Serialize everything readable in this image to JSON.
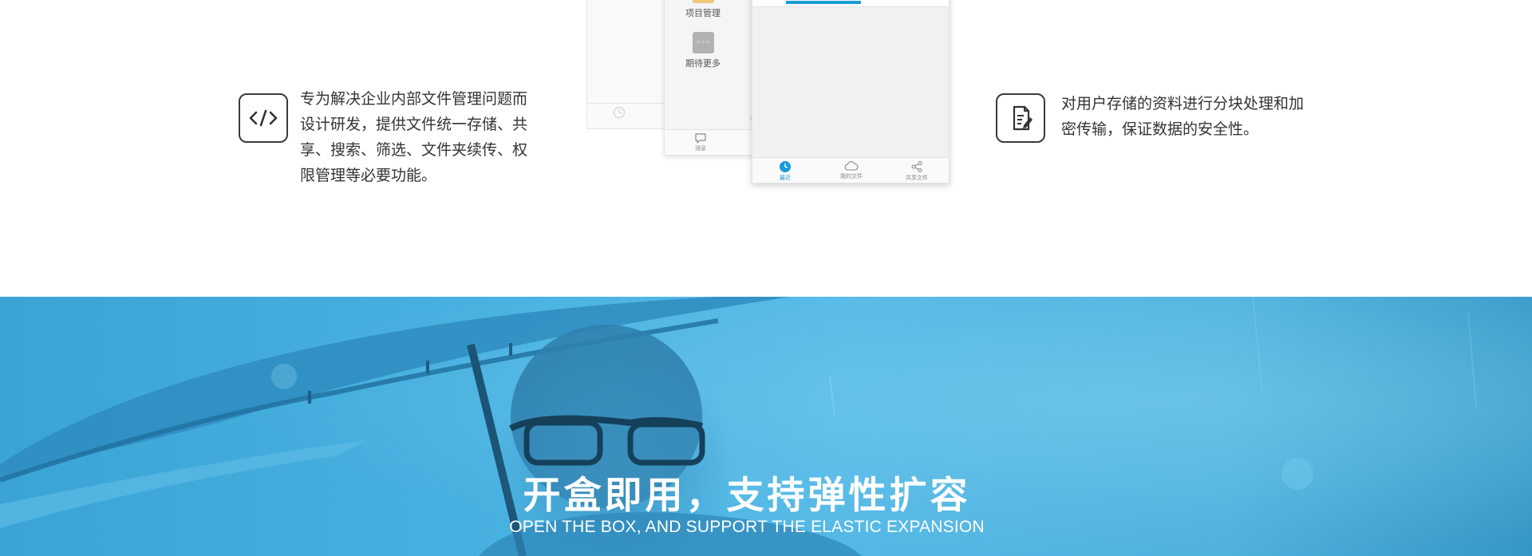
{
  "features": {
    "left": {
      "icon": "code-icon",
      "lines": [
        "专为解决企业内部文件管理问题而",
        "设计研发，提供文件统一存储、共",
        "享、搜索、筛选、文件夹续传、权",
        "限管理等必要功能。"
      ]
    },
    "right": {
      "icon": "document-edit-icon",
      "lines": [
        "对用户存储的资料进行分块处理和加",
        "密传输，保证数据的安全性。"
      ]
    }
  },
  "phone": {
    "menu": [
      {
        "label": "项目管理",
        "icon": "project-icon"
      },
      {
        "label": "期待更多",
        "icon": "more-icon",
        "glyph": "◦◦◦"
      }
    ],
    "mid_tab": {
      "label": "消息",
      "icon": "message-icon"
    },
    "front_tabs": [
      {
        "label": "最近",
        "icon": "clock-icon",
        "active": true
      },
      {
        "label": "我的文件",
        "icon": "cloud-icon",
        "active": false
      },
      {
        "label": "共享文件",
        "icon": "share-icon",
        "active": false
      }
    ],
    "accent_color": "#1a9ad8"
  },
  "banner": {
    "title": "开盒即用，支持弹性扩容",
    "subtitle": "OPEN THE BOX, AND SUPPORT THE ELASTIC EXPANSION",
    "color": "#46b0e0"
  }
}
